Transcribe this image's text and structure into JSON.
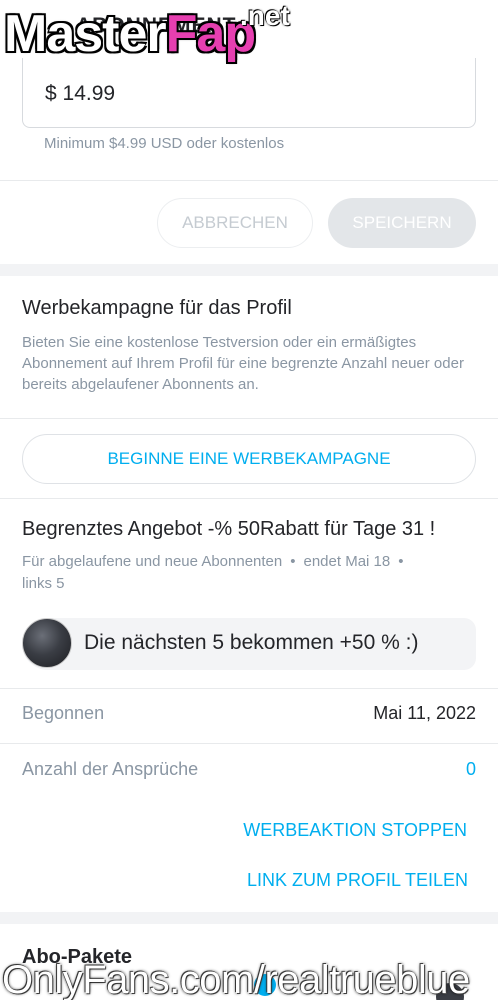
{
  "header": {
    "title": "ABONNEMENT",
    "watermark_main": "Master",
    "watermark_accent": "Fap",
    "watermark_net": ".net"
  },
  "price": {
    "value": "$  14.99",
    "hint": "Minimum $4.99 USD oder kostenlos"
  },
  "actions": {
    "cancel_label": "ABBRECHEN",
    "save_label": "SPEICHERN"
  },
  "campaign": {
    "title": "Werbekampagne für das Profil",
    "description": "Bieten Sie eine kostenlose Testversion oder ein ermäßigtes Abonnement auf Ihrem Profil für eine begrenzte Anzahl neuer oder bereits abgelaufener Abonnents an.",
    "button_label": "BEGINNE EINE WERBEKAMPAGNE"
  },
  "offer": {
    "title": "Begrenztes Angebot -% 50Rabatt für Tage 31 !",
    "audience": "Für abgelaufene und neue Abonnenten",
    "ends": "endet Mai 18",
    "remaining": "links 5",
    "message": "Die nächsten 5 bekommen +50 % :)",
    "started_label": "Begonnen",
    "started_value": "Mai 11, 2022",
    "claims_label": "Anzahl der Ansprüche",
    "claims_value": "0",
    "stop_label": "WERBEAKTION STOPPEN",
    "share_label": "LINK ZUM PROFIL TEILEN"
  },
  "packages": {
    "title": "Abo-Pakete"
  },
  "footer": {
    "watermark": "OnlyFans.com/realtrueblue"
  },
  "colors": {
    "accent": "#00aeef",
    "muted": "#8a96a3",
    "text": "#242529",
    "watermark_accent": "#e63fb0"
  }
}
